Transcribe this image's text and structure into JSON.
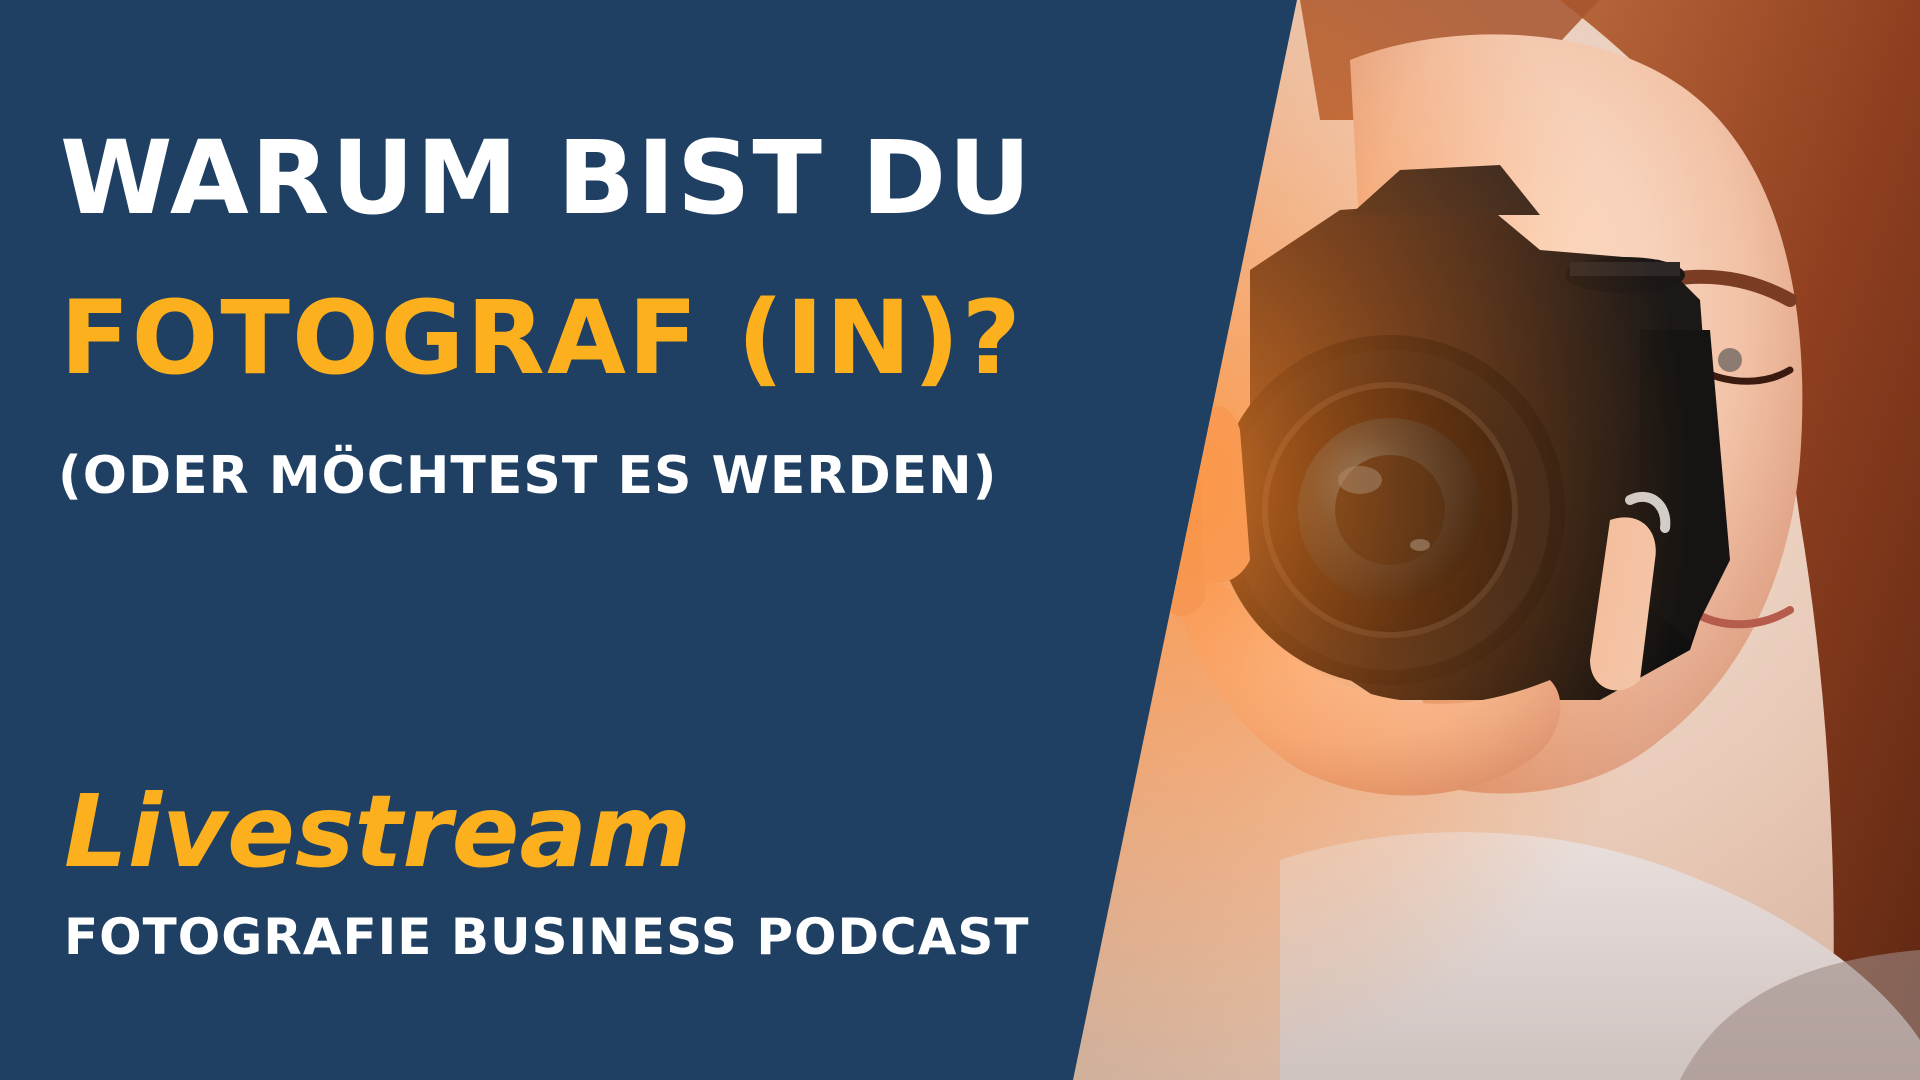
{
  "headline": {
    "line1": "WARUM BIST DU",
    "line2": "FOTOGRAF (IN)?",
    "subline": "(ODER MÖCHTEST ES WERDEN)"
  },
  "footer": {
    "livestream": "Livestream",
    "podcast": "FOTOGRAFIE BUSINESS PODCAST"
  },
  "colors": {
    "background": "#1f4063",
    "accent": "#fdb01e",
    "text": "#ffffff"
  },
  "photo": {
    "subject": "woman-with-camera"
  }
}
